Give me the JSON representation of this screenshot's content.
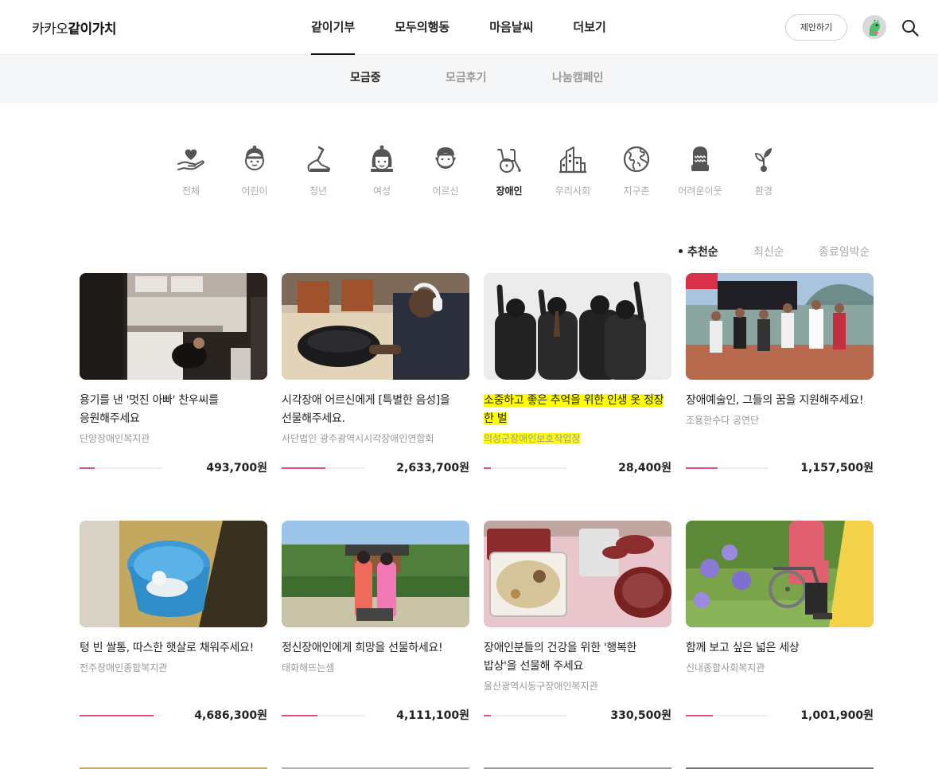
{
  "header": {
    "logo_light": "카카오",
    "logo_bold": "같이가치",
    "nav": [
      {
        "label": "같이기부",
        "active": true
      },
      {
        "label": "모두의행동",
        "active": false
      },
      {
        "label": "마음날씨",
        "active": false
      },
      {
        "label": "더보기",
        "active": false
      }
    ],
    "propose_label": "제안하기",
    "icons": {
      "avatar": "dinosaur-avatar-icon",
      "search": "search-icon"
    }
  },
  "subnav": [
    {
      "label": "모금중",
      "active": true
    },
    {
      "label": "모금후기",
      "active": false
    },
    {
      "label": "나눔캠페인",
      "active": false
    }
  ],
  "categories": [
    {
      "label": "전체",
      "icon": "heart-hand-icon",
      "active": false
    },
    {
      "label": "어린이",
      "icon": "child-icon",
      "active": false
    },
    {
      "label": "청년",
      "icon": "walking-shoe-icon",
      "active": false
    },
    {
      "label": "여성",
      "icon": "woman-icon",
      "active": false
    },
    {
      "label": "어르신",
      "icon": "elder-icon",
      "active": false
    },
    {
      "label": "장애인",
      "icon": "wheelchair-icon",
      "active": true
    },
    {
      "label": "우리사회",
      "icon": "buildings-icon",
      "active": false
    },
    {
      "label": "지구촌",
      "icon": "globe-icon",
      "active": false
    },
    {
      "label": "어려운이웃",
      "icon": "mitten-icon",
      "active": false
    },
    {
      "label": "환경",
      "icon": "sprout-icon",
      "active": false
    }
  ],
  "sort": [
    {
      "label": "추천순",
      "active": true
    },
    {
      "label": "최신순",
      "active": false
    },
    {
      "label": "종료임박순",
      "active": false
    }
  ],
  "colors": {
    "accent": "#e0508a",
    "highlight": "#ffff00"
  },
  "cards": [
    {
      "title": "용기를 낸 '멋진 아빠' 찬우씨를 응원해주세요",
      "org": "단양장애인복지관",
      "amount": "493,700원",
      "progress": 0.18,
      "highlight": false
    },
    {
      "title": "시각장애 어르신에게 [특별한 음성]을 선물해주세요.",
      "org": "사단법인 광주광역시시각장애인연합회",
      "amount": "2,633,700원",
      "progress": 0.53,
      "highlight": false
    },
    {
      "title": "소중하고 좋은 추억을 위한 인생 옷 정장 한 벌",
      "org": "의성군장애인보호작업장",
      "amount": "28,400원",
      "progress": 0.09,
      "highlight": true
    },
    {
      "title": "장애예술인, 그들의 꿈을 지원해주세요!",
      "org": "조용한수다 공연단",
      "amount": "1,157,500원",
      "progress": 0.38,
      "highlight": false
    },
    {
      "title": "텅 빈 쌀통, 따스한 햇살로 채워주세요!",
      "org": "전주장애인종합복지관",
      "amount": "4,686,300원",
      "progress": 0.89,
      "highlight": false
    },
    {
      "title": "정신장애인에게 희망을 선물하세요!",
      "org": "태화해뜨는샘",
      "amount": "4,111,100원",
      "progress": 0.43,
      "highlight": false
    },
    {
      "title": "장애인분들의 건강을 위한 '행복한 밥상'을 선물해 주세요",
      "org": "울산광역시동구장애인복지관",
      "amount": "330,500원",
      "progress": 0.09,
      "highlight": false
    },
    {
      "title": "함께 보고 싶은 넓은 세상",
      "org": "신내종합사회복지관",
      "amount": "1,001,900원",
      "progress": 0.33,
      "highlight": false
    }
  ]
}
